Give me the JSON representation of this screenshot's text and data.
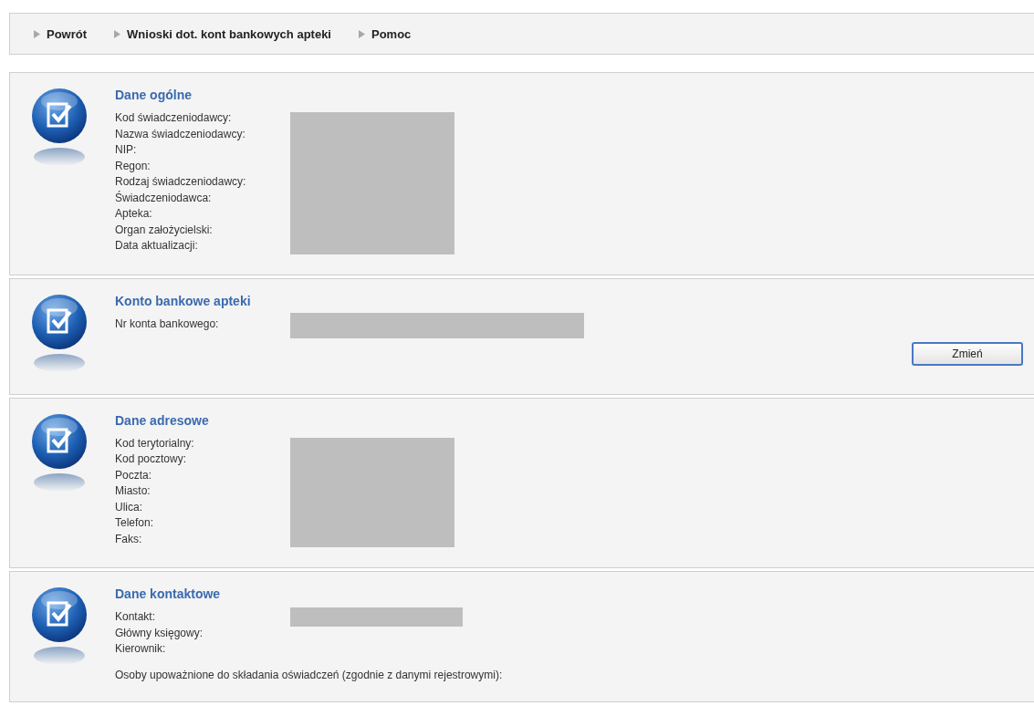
{
  "nav": [
    {
      "label": "Powrót"
    },
    {
      "label": "Wnioski dot. kont bankowych apteki"
    },
    {
      "label": "Pomoc"
    }
  ],
  "sections": [
    {
      "title": "Dane ogólne",
      "labels": [
        "Kod świadczeniodawcy:",
        "Nazwa świadczeniodawcy:",
        "NIP:",
        "Regon:",
        "Rodzaj świadczeniodawcy:",
        "Świadczeniodawca:",
        "Apteka:",
        "Organ założycielski:",
        "Data aktualizacji:"
      ],
      "redaction": {
        "kind": "block"
      }
    },
    {
      "title": "Konto bankowe apteki",
      "labels": [
        "Nr konta bankowego:"
      ],
      "redaction": {
        "kind": "wide-bar"
      },
      "button": "Zmień"
    },
    {
      "title": "Dane adresowe",
      "labels": [
        "Kod terytorialny:",
        "Kod pocztowy:",
        "Poczta:",
        "Miasto:",
        "Ulica:",
        "Telefon:",
        "Faks:"
      ],
      "redaction": {
        "kind": "block"
      }
    },
    {
      "title": "Dane kontaktowe",
      "labels": [
        "Kontakt:",
        "Główny księgowy:",
        "Kierownik:"
      ],
      "redaction": {
        "kind": "bar"
      },
      "note": "Osoby upoważnione do składania oświadczeń (zgodnie z danymi rejestrowymi):"
    }
  ]
}
